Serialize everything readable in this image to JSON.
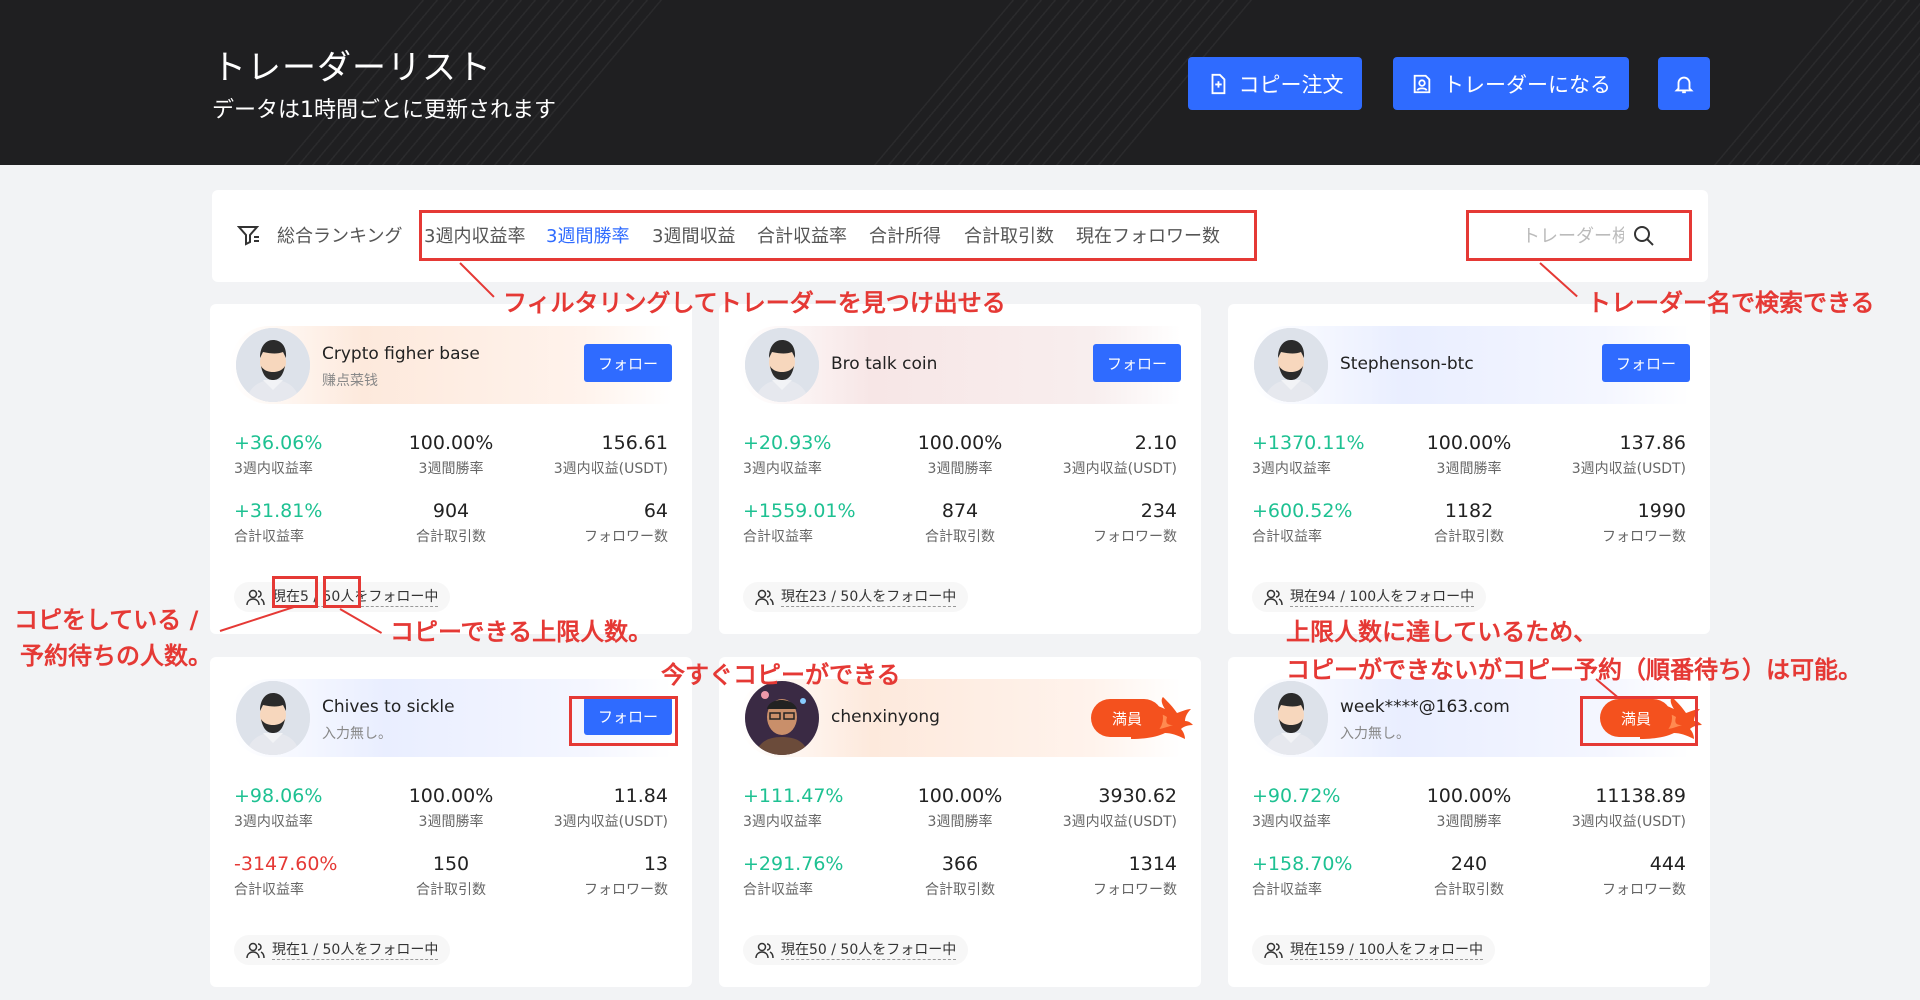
{
  "header": {
    "title": "トレーダーリスト",
    "subtitle": "データは1時間ごとに更新されます",
    "copy_order_label": "コピー注文",
    "become_trader_label": "トレーダーになる"
  },
  "filter": {
    "ranking_label": "総合ランキング",
    "tabs": [
      "3週内収益率",
      "3週間勝率",
      "3週間収益",
      "合計収益率",
      "合計所得",
      "合計取引数",
      "現在フォロワー数"
    ],
    "active_tab": "3週間勝率",
    "search_placeholder": "トレーダー検索"
  },
  "labels": {
    "follow": "フォロー",
    "full": "満員",
    "roi_3w": "3週内収益率",
    "winrate_3w": "3週間勝率",
    "profit_3w": "3週内収益(USDT)",
    "total_roi": "合計収益率",
    "total_trades": "合計取引数",
    "followers": "フォロワー数"
  },
  "traders": [
    {
      "name": "Crypto figher base",
      "desc": "赚点菜钱",
      "roi_3w": "+36.06%",
      "winrate_3w": "100.00%",
      "profit_3w": "156.61",
      "total_roi": "+31.81%",
      "total_trades": "904",
      "followers": "64",
      "capacity": "現在5 / 50人をフォロー中",
      "status": "follow"
    },
    {
      "name": "Bro talk coin",
      "desc": "",
      "roi_3w": "+20.93%",
      "winrate_3w": "100.00%",
      "profit_3w": "2.10",
      "total_roi": "+1559.01%",
      "total_trades": "874",
      "followers": "234",
      "capacity": "現在23 / 50人をフォロー中",
      "status": "follow"
    },
    {
      "name": "Stephenson-btc",
      "desc": "",
      "roi_3w": "+1370.11%",
      "winrate_3w": "100.00%",
      "profit_3w": "137.86",
      "total_roi": "+600.52%",
      "total_trades": "1182",
      "followers": "1990",
      "capacity": "現在94 / 100人をフォロー中",
      "status": "follow"
    },
    {
      "name": "Chives to sickle",
      "desc": "入力無し。",
      "roi_3w": "+98.06%",
      "winrate_3w": "100.00%",
      "profit_3w": "11.84",
      "total_roi": "-3147.60%",
      "total_trades": "150",
      "followers": "13",
      "capacity": "現在1 / 50人をフォロー中",
      "status": "follow"
    },
    {
      "name": "chenxinyong",
      "desc": "",
      "roi_3w": "+111.47%",
      "winrate_3w": "100.00%",
      "profit_3w": "3930.62",
      "total_roi": "+291.76%",
      "total_trades": "366",
      "followers": "1314",
      "capacity": "現在50 / 50人をフォロー中",
      "status": "full"
    },
    {
      "name": "week****@163.com",
      "desc": "入力無し。",
      "roi_3w": "+90.72%",
      "winrate_3w": "100.00%",
      "profit_3w": "11138.89",
      "total_roi": "+158.70%",
      "total_trades": "240",
      "followers": "444",
      "capacity": "現在159 / 100人をフォロー中",
      "status": "full"
    }
  ],
  "annotations": {
    "filter_note": "フィルタリングしてトレーダーを見つけ出せる",
    "search_note": "トレーダー名で検索できる",
    "copy_count_note_line1": "コピをしている /",
    "copy_count_note_line2": "予約待ちの人数。",
    "limit_note": "コピーできる上限人数。",
    "can_copy_note": "今すぐコピーができる",
    "full_note_line1": "上限人数に達しているため、",
    "full_note_line2": "コピーができないがコピー予約（順番待ち）は可能。"
  },
  "colors": {
    "accent": "#2f6bff",
    "positive": "#1ec192",
    "negative": "#e53935",
    "full_badge": "#f4511e",
    "annotation": "#e53935"
  }
}
